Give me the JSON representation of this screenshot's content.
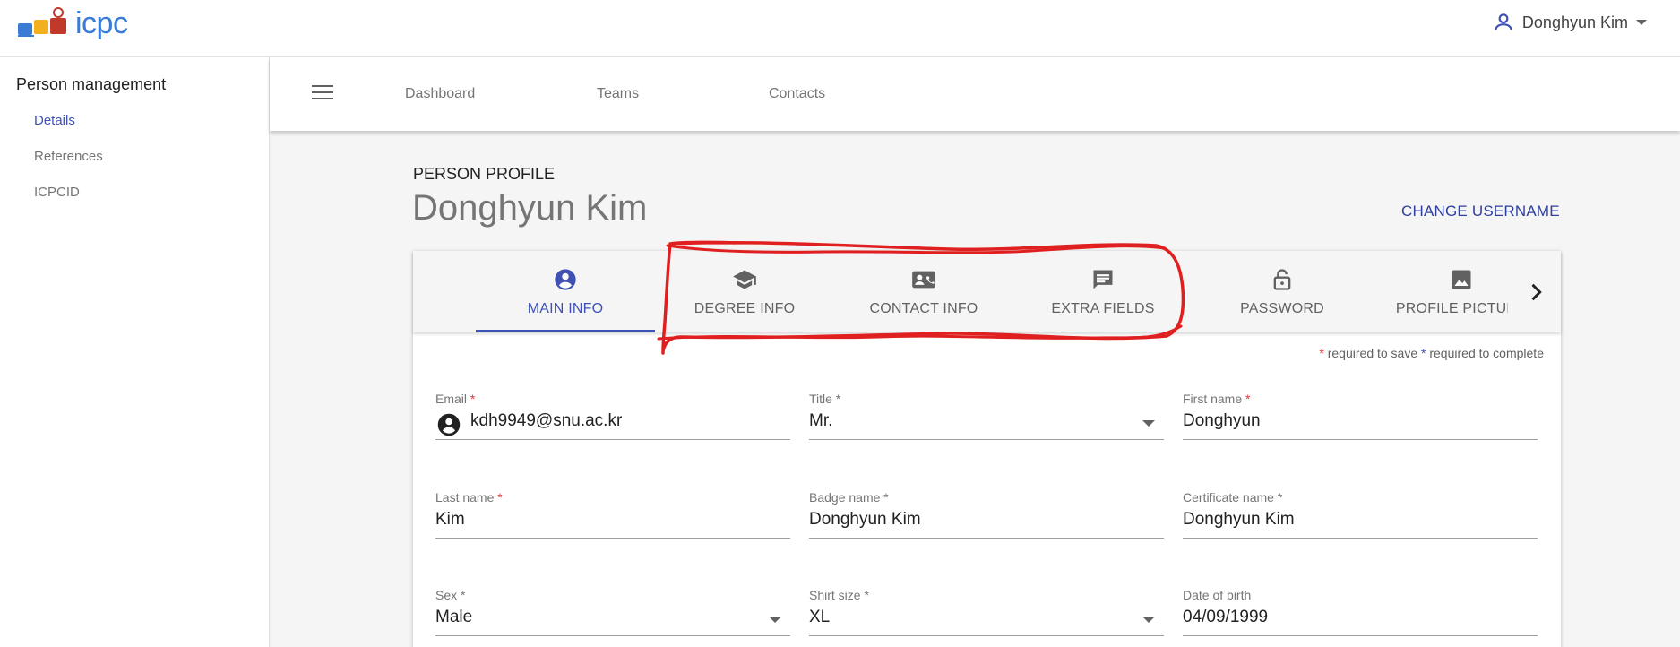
{
  "header": {
    "logo_text": "icpc",
    "user_name": "Donghyun Kim"
  },
  "sidebar": {
    "title": "Person management",
    "items": [
      {
        "label": "Details",
        "active": true
      },
      {
        "label": "References",
        "active": false
      },
      {
        "label": "ICPCID",
        "active": false
      }
    ]
  },
  "nav": {
    "links": [
      "Dashboard",
      "Teams",
      "Contacts"
    ]
  },
  "profile": {
    "label": "PERSON PROFILE",
    "name": "Donghyun Kim",
    "change_username": "CHANGE USERNAME"
  },
  "tabs": [
    {
      "label": "MAIN INFO",
      "icon": "account-circle-icon",
      "active": true
    },
    {
      "label": "DEGREE INFO",
      "icon": "school-icon",
      "active": false
    },
    {
      "label": "CONTACT INFO",
      "icon": "contact-card-icon",
      "active": false
    },
    {
      "label": "EXTRA FIELDS",
      "icon": "comment-icon",
      "active": false
    },
    {
      "label": "PASSWORD",
      "icon": "lock-open-icon",
      "active": false
    },
    {
      "label": "PROFILE PICTURE",
      "icon": "image-icon",
      "active": false
    }
  ],
  "required_note": {
    "star1": "*",
    "text1": " required to save ",
    "star2": "*",
    "text2": " required to complete"
  },
  "form": {
    "email": {
      "label": "Email",
      "value": "kdh9949@snu.ac.kr"
    },
    "title": {
      "label": "Title *",
      "value": "Mr."
    },
    "first_name": {
      "label": "First name",
      "value": "Donghyun"
    },
    "last_name": {
      "label": "Last name",
      "value": "Kim"
    },
    "badge_name": {
      "label": "Badge name *",
      "value": "Donghyun Kim"
    },
    "certificate_name": {
      "label": "Certificate name *",
      "value": "Donghyun Kim"
    },
    "sex": {
      "label": "Sex *",
      "value": "Male"
    },
    "shirt_size": {
      "label": "Shirt size *",
      "value": "XL"
    },
    "date_of_birth": {
      "label": "Date of birth",
      "value": "04/09/1999"
    }
  },
  "colors": {
    "accent": "#3f51b5",
    "required": "#e53935",
    "annotation": "#e02020"
  }
}
